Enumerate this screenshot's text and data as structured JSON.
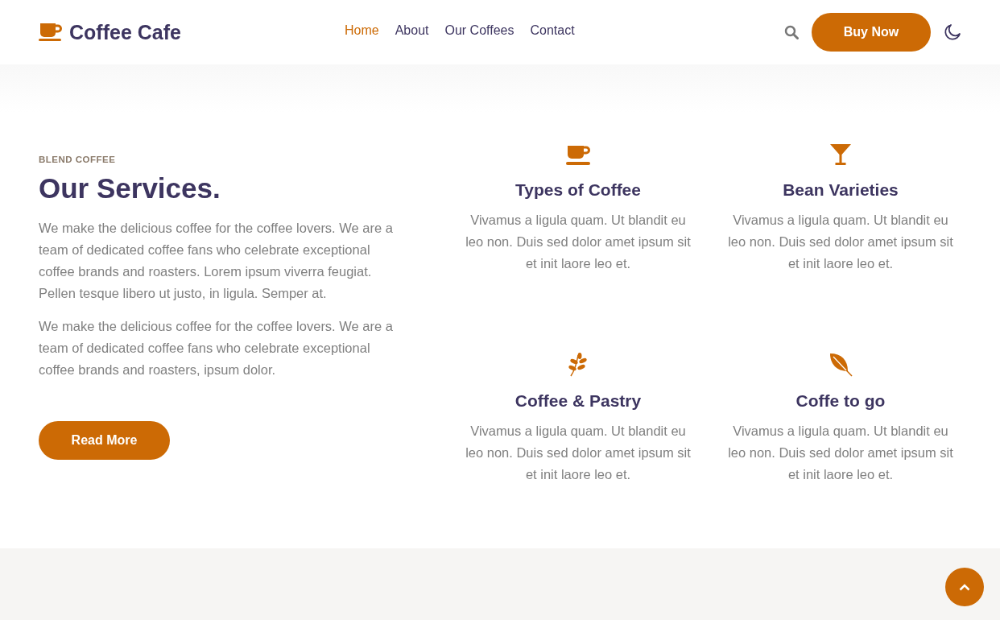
{
  "header": {
    "brand": "Coffee Cafe",
    "nav": [
      {
        "label": "Home",
        "selected": true
      },
      {
        "label": "About",
        "selected": false
      },
      {
        "label": "Our Coffees",
        "selected": false
      },
      {
        "label": "Contact",
        "selected": false
      }
    ],
    "buy_button": "Buy Now"
  },
  "intro": {
    "eyebrow": "BLEND COFFEE",
    "title": "Our Services.",
    "paragraphs": [
      "We make the delicious coffee for the coffee lovers. We are a team of dedicated coffee fans who celebrate exceptional coffee brands and roasters. Lorem ipsum viverra feugiat. Pellen tesque libero ut justo, in ligula. Semper at.",
      "We make the delicious coffee for the coffee lovers. We are a team of dedicated coffee fans who celebrate exceptional coffee brands and roasters, ipsum dolor."
    ],
    "button": "Read More"
  },
  "services": [
    {
      "title": "Types of Coffee",
      "text": "Vivamus a ligula quam. Ut blandit eu leo non. Duis sed dolor amet ipsum sit et init laore leo et."
    },
    {
      "title": "Bean Varieties",
      "text": "Vivamus a ligula quam. Ut blandit eu leo non. Duis sed dolor amet ipsum sit et init laore leo et."
    },
    {
      "title": "Coffee & Pastry",
      "text": "Vivamus a ligula quam. Ut blandit eu leo non. Duis sed dolor amet ipsum sit et init laore leo et."
    },
    {
      "title": "Coffe to go",
      "text": "Vivamus a ligula quam. Ut blandit eu leo non. Duis sed dolor amet ipsum sit et init laore leo et."
    }
  ]
}
